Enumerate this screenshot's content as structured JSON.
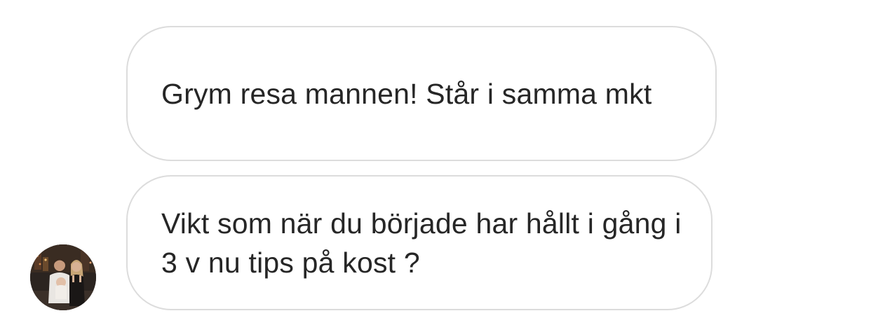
{
  "messages": [
    {
      "text": "Grym resa mannen! Står i samma mkt"
    },
    {
      "text": "Vikt som när du började har hållt i gång i 3 v nu tips på kost ?"
    }
  ],
  "sender": {
    "avatar_icon": "user-photo-avatar"
  },
  "colors": {
    "background": "#ffffff",
    "bubble_border": "#dcdcdc",
    "text": "#262626"
  }
}
